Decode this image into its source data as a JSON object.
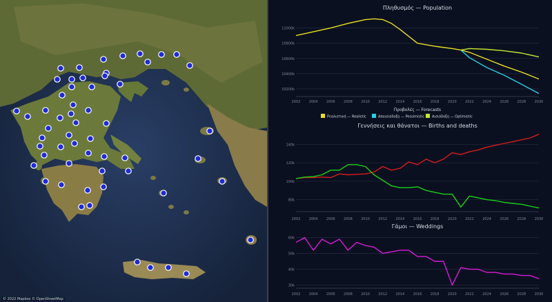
{
  "map": {
    "attribution": "© 2022 Mapbox © OpenStreetMap",
    "marker_color": "#1f2bd6",
    "marker_count": 57
  },
  "colors": {
    "realistic": "#e8e020",
    "pessimistic": "#22d3e6",
    "optimistic": "#c6e830",
    "births": "#d81b1b",
    "deaths": "#19d219",
    "weddings": "#d81ad8",
    "text": "#d8dde6",
    "tick": "#7f8796",
    "grid": "#263043"
  },
  "chart_data": [
    {
      "type": "line",
      "title": "Πληθυσμός — Population",
      "x_ticks": [
        "2002",
        "2004",
        "2006",
        "2008",
        "2010",
        "2012",
        "2014",
        "2016",
        "2018",
        "2020",
        "2022",
        "2024",
        "2026",
        "2028",
        "2030"
      ],
      "y_ticks": [
        "11000k",
        "10800k",
        "10600k",
        "10400k",
        "10200k"
      ],
      "ylim": [
        10100000,
        11150000
      ],
      "legend_title": "Προβολές — Forecasts",
      "legend": [
        "Ρεαλιστική — Realistic",
        "Απαισιόδοξη — Pessimistic",
        "Αισιόδοξη — Optimistic"
      ],
      "legend_position": "bottom",
      "series": [
        {
          "name": "Ρεαλιστική — Realistic",
          "color_key": "realistic",
          "x": [
            2002,
            2004,
            2006,
            2008,
            2010,
            2011,
            2012,
            2013,
            2014,
            2016,
            2018,
            2020,
            2021,
            2022,
            2024,
            2026,
            2028,
            2030
          ],
          "y": [
            10900000,
            10950000,
            11000000,
            11060000,
            11110000,
            11120000,
            11110000,
            11060000,
            10980000,
            10800000,
            10760000,
            10730000,
            10710000,
            10680000,
            10590000,
            10500000,
            10420000,
            10330000
          ]
        },
        {
          "name": "Απαισιόδοξη — Pessimistic",
          "color_key": "pessimistic",
          "x": [
            2021,
            2022,
            2024,
            2026,
            2028,
            2030
          ],
          "y": [
            10710000,
            10610000,
            10480000,
            10380000,
            10260000,
            10140000
          ]
        },
        {
          "name": "Αισιόδοξη — Optimistic",
          "color_key": "optimistic",
          "x": [
            2021,
            2022,
            2024,
            2026,
            2028,
            2030
          ],
          "y": [
            10710000,
            10730000,
            10720000,
            10700000,
            10670000,
            10620000
          ]
        }
      ]
    },
    {
      "type": "line",
      "title": "Γεννήσεις και θάνατοι — Births and deaths",
      "x_ticks": [
        "2002",
        "2004",
        "2006",
        "2008",
        "2010",
        "2012",
        "2014",
        "2016",
        "2018",
        "2020",
        "2022",
        "2024",
        "2026",
        "2028",
        "2030"
      ],
      "y_ticks": [
        "140k",
        "120k",
        "100k",
        "80k"
      ],
      "ylim": [
        67000,
        150000
      ],
      "series": [
        {
          "name": "births",
          "color_key": "births",
          "x": [
            2002,
            2003,
            2004,
            2005,
            2006,
            2007,
            2008,
            2009,
            2010,
            2011,
            2012,
            2013,
            2014,
            2015,
            2016,
            2017,
            2018,
            2019,
            2020,
            2021,
            2022,
            2023,
            2024,
            2025,
            2026,
            2027,
            2028,
            2029,
            2030
          ],
          "y": [
            103000,
            104000,
            104000,
            104500,
            104000,
            108000,
            107000,
            107500,
            108000,
            110000,
            116000,
            112000,
            114000,
            121000,
            118000,
            124000,
            120000,
            124000,
            131000,
            129000,
            132000,
            134000,
            137000,
            139000,
            141000,
            143000,
            145000,
            147000,
            151000
          ]
        },
        {
          "name": "deaths",
          "color_key": "deaths",
          "x": [
            2002,
            2003,
            2004,
            2005,
            2006,
            2007,
            2008,
            2009,
            2010,
            2011,
            2012,
            2013,
            2014,
            2015,
            2016,
            2017,
            2018,
            2019,
            2020,
            2021,
            2022,
            2023,
            2024,
            2025,
            2026,
            2027,
            2028,
            2029,
            2030
          ],
          "y": [
            103000,
            104500,
            105000,
            107000,
            112000,
            112000,
            118000,
            118000,
            116000,
            107000,
            101000,
            95000,
            93000,
            93000,
            94000,
            90000,
            88000,
            86000,
            86000,
            72000,
            84000,
            82000,
            80000,
            79000,
            77000,
            76000,
            75000,
            73000,
            71000
          ]
        }
      ]
    },
    {
      "type": "line",
      "title": "Γάμοι — Weddings",
      "x_ticks": [
        "2002",
        "2004",
        "2006",
        "2008",
        "2010",
        "2012",
        "2014",
        "2016",
        "2018",
        "2020",
        "2022",
        "2024",
        "2026",
        "2028",
        "2030"
      ],
      "y_ticks": [
        "60k",
        "50k",
        "40k",
        "30k"
      ],
      "ylim": [
        28000,
        62000
      ],
      "series": [
        {
          "name": "weddings",
          "color_key": "weddings",
          "x": [
            2002,
            2003,
            2004,
            2005,
            2006,
            2007,
            2008,
            2009,
            2010,
            2011,
            2012,
            2013,
            2014,
            2015,
            2016,
            2017,
            2018,
            2019,
            2020,
            2021,
            2022,
            2023,
            2024,
            2025,
            2026,
            2027,
            2028,
            2029,
            2030
          ],
          "y": [
            57000,
            60000,
            52000,
            59000,
            56000,
            59000,
            52000,
            57000,
            55000,
            54000,
            50000,
            51000,
            52000,
            52000,
            48000,
            48000,
            45000,
            45000,
            30000,
            41000,
            40000,
            40000,
            38000,
            38000,
            37000,
            37000,
            36000,
            36000,
            34000
          ]
        }
      ]
    }
  ]
}
